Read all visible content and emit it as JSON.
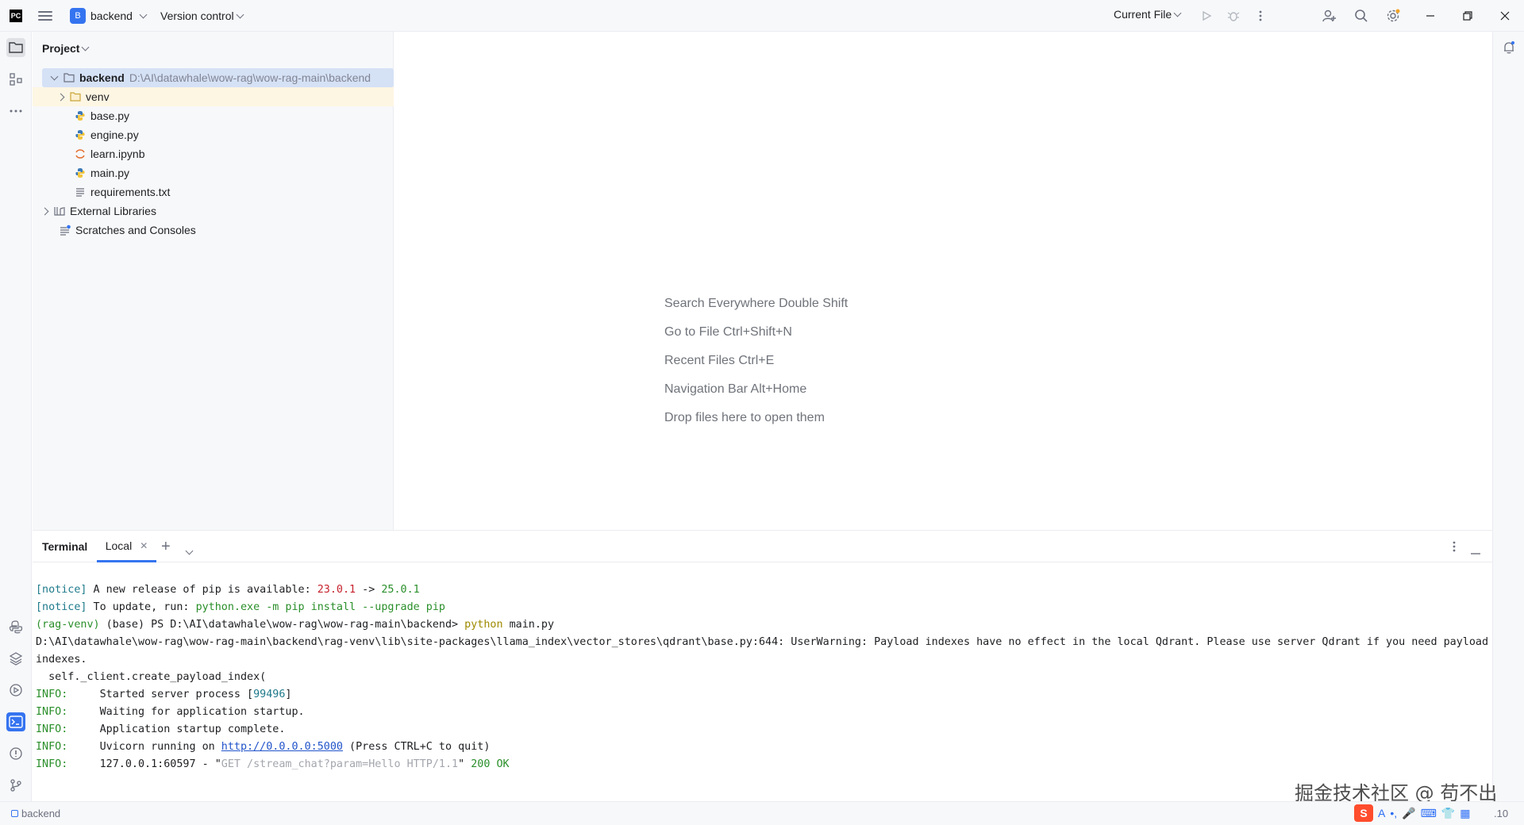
{
  "titlebar": {
    "logo": "PC",
    "project_badge": "B",
    "project_name": "backend",
    "version_control": "Version control",
    "run_config": "Current File"
  },
  "project_panel": {
    "header": "Project",
    "root": {
      "name": "backend",
      "path": "D:\\AI\\datawhale\\wow-rag\\wow-rag-main\\backend"
    },
    "items": [
      {
        "name": "venv",
        "kind": "folder"
      },
      {
        "name": "base.py",
        "kind": "python"
      },
      {
        "name": "engine.py",
        "kind": "python"
      },
      {
        "name": "learn.ipynb",
        "kind": "notebook"
      },
      {
        "name": "main.py",
        "kind": "python"
      },
      {
        "name": "requirements.txt",
        "kind": "text"
      }
    ],
    "external_libraries": "External Libraries",
    "scratches": "Scratches and Consoles"
  },
  "editor_hints": [
    {
      "text": "Search Everywhere",
      "key": "Double Shift"
    },
    {
      "text": "Go to File",
      "key": "Ctrl+Shift+N"
    },
    {
      "text": "Recent Files",
      "key": "Ctrl+E"
    },
    {
      "text": "Navigation Bar",
      "key": "Alt+Home"
    },
    {
      "text": "Drop files here to open them",
      "key": ""
    }
  ],
  "terminal": {
    "title": "Terminal",
    "tab": "Local",
    "lines": {
      "l1_tag": "[notice]",
      "l1_text": " A new release of pip is available: ",
      "l1_old": "23.0.1",
      "l1_arrow": " -> ",
      "l1_new": "25.0.1",
      "l2_tag": "[notice]",
      "l2_text": " To update, run: ",
      "l2_cmd": "python.exe -m pip install --upgrade pip",
      "l3_env": "(rag-venv)",
      "l3_prompt": " (base) PS D:\\AI\\datawhale\\wow-rag\\wow-rag-main\\backend> ",
      "l3_py": "python",
      "l3_arg": " main.py",
      "l4": "D:\\AI\\datawhale\\wow-rag\\wow-rag-main\\backend\\rag-venv\\lib\\site-packages\\llama_index\\vector_stores\\qdrant\\base.py:644: UserWarning: Payload indexes have no effect in the local Qdrant. Please use server Qdrant if you need payload",
      "l5": "indexes.",
      "l6": "  self._client.create_payload_index(",
      "l7_tag": "INFO:",
      "l7_text": "     Started server process [",
      "l7_pid": "99496",
      "l7_end": "]",
      "l8_tag": "INFO:",
      "l8_text": "     Waiting for application startup.",
      "l9_tag": "INFO:",
      "l9_text": "     Application startup complete.",
      "l10_tag": "INFO:",
      "l10_text": "     Uvicorn running on ",
      "l10_url": "http://0.0.0.0:5000",
      "l10_end": " (Press CTRL+C to quit)",
      "l11_tag": "INFO:",
      "l11_text": "     127.0.0.1:60597 - \"",
      "l11_req": "GET /stream_chat?param=Hello HTTP/1.1",
      "l11_q": "\" ",
      "l11_status": "200 OK"
    }
  },
  "statusbar": {
    "crumb": "backend",
    "version_fragment": ".10",
    "watermark": "掘金技术社区 @ 苟不出"
  },
  "colors": {
    "accent": "#3574f0",
    "selection": "#d5e1f5"
  }
}
